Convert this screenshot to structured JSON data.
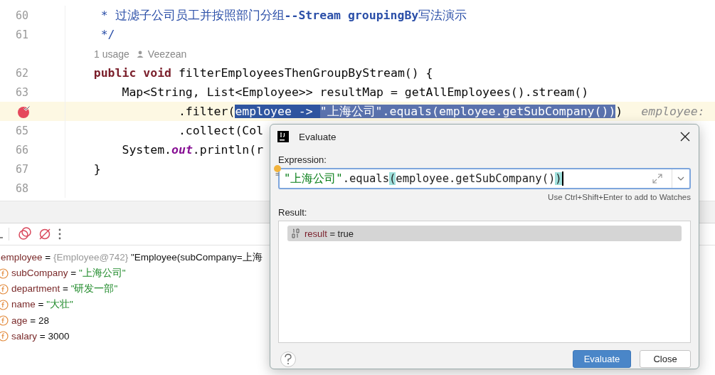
{
  "editor": {
    "lines": [
      {
        "number": "60",
        "breakpoint": false,
        "current": false,
        "segments": [
          {
            "kind": "comment",
            "text": "     * 过滤子公司员工并按照部门分组"
          },
          {
            "kind": "comment-bold",
            "text": "--Stream groupingBy"
          },
          {
            "kind": "comment",
            "text": "写法演示"
          }
        ]
      },
      {
        "number": "61",
        "breakpoint": false,
        "current": false,
        "segments": [
          {
            "kind": "comment",
            "text": "     */"
          }
        ]
      },
      {
        "kind": "usage",
        "usages": "1 usage",
        "author": "Veezean"
      },
      {
        "number": "62",
        "breakpoint": false,
        "current": false,
        "segments": [
          {
            "kind": "keyword",
            "text": "    public void"
          },
          {
            "kind": "plain",
            "text": " filterEmployeesThenGroupByStream() {"
          }
        ]
      },
      {
        "number": "63",
        "breakpoint": false,
        "current": false,
        "segments": [
          {
            "kind": "plain",
            "text": "        Map<String, List<Employee>> resultMap = getAllEmployees().stream()"
          }
        ]
      },
      {
        "breakpoint": true,
        "current": true,
        "segments": [
          {
            "kind": "plain",
            "text": "                .filter("
          },
          {
            "kind": "selection-strong",
            "text": "employee -> "
          },
          {
            "kind": "selection",
            "text": "\"上海公司\".equals(employee.getSubCompany())"
          },
          {
            "kind": "plain",
            "text": ")"
          },
          {
            "kind": "hint",
            "text": "employee:"
          }
        ]
      },
      {
        "number": "65",
        "breakpoint": false,
        "current": false,
        "segments": [
          {
            "kind": "plain",
            "text": "                .collect(Col"
          }
        ]
      },
      {
        "number": "66",
        "breakpoint": false,
        "current": false,
        "segments": [
          {
            "kind": "plain",
            "text": "        System."
          },
          {
            "kind": "static",
            "text": "out"
          },
          {
            "kind": "plain",
            "text": ".println(r"
          }
        ]
      },
      {
        "number": "67",
        "breakpoint": false,
        "current": false,
        "segments": [
          {
            "kind": "plain",
            "text": "    }"
          }
        ]
      },
      {
        "number": "68",
        "breakpoint": false,
        "current": false
      }
    ]
  },
  "variables": [
    {
      "name": "employee",
      "operator": "=",
      "type": "{Employee@742}",
      "value": "\"Employee(subCompany=上海",
      "children": [
        {
          "name": "subCompany",
          "operator": "=",
          "kind": "string",
          "value": "\"上海公司\""
        },
        {
          "name": "department",
          "operator": "=",
          "kind": "string",
          "value": "\"研发一部\""
        },
        {
          "name": "name",
          "operator": "=",
          "kind": "string",
          "value": "\"大壮\""
        },
        {
          "name": "age",
          "operator": "=",
          "kind": "number",
          "value": "28"
        },
        {
          "name": "salary",
          "operator": "=",
          "kind": "number",
          "value": "3000"
        }
      ]
    }
  ],
  "dialog": {
    "title": "Evaluate",
    "expression_label": "Expression:",
    "expression": [
      {
        "kind": "string",
        "text": "\"上海公司\""
      },
      {
        "kind": "plain",
        "text": ".equals"
      },
      {
        "kind": "match",
        "text": "("
      },
      {
        "kind": "plain",
        "text": "employee.getSubCompany()"
      },
      {
        "kind": "match",
        "text": ")"
      }
    ],
    "hint": "Use Ctrl+Shift+Enter to add to Watches",
    "result_label": "Result:",
    "results": [
      {
        "name": "result",
        "operator": "=",
        "value": "true",
        "selected": true
      }
    ],
    "buttons": [
      {
        "label": "Evaluate",
        "primary": true
      },
      {
        "label": "Close",
        "primary": false
      }
    ]
  }
}
